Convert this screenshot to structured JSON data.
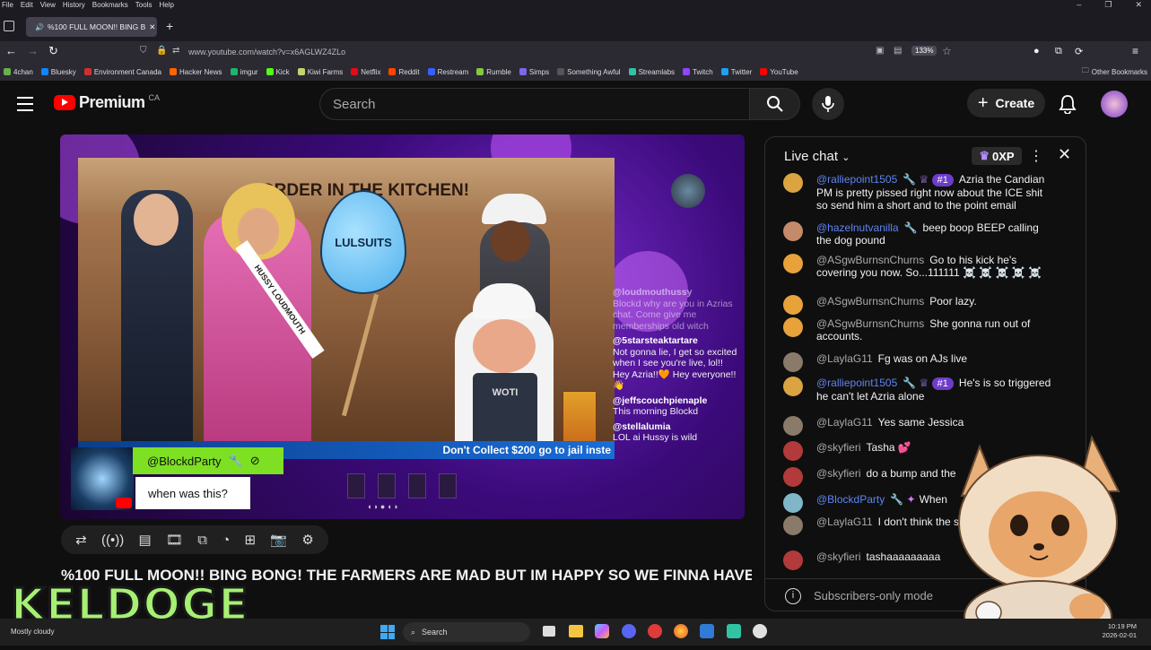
{
  "browser": {
    "menu": [
      "File",
      "Edit",
      "View",
      "History",
      "Bookmarks",
      "Tools",
      "Help"
    ],
    "tab_title": "%100 FULL MOON!! BING B",
    "url": "www.youtube.com/watch?v=x6AGLWZ4ZLo",
    "zoom": "133%",
    "bookmarks": [
      {
        "label": "4chan",
        "color": "#6ab04c"
      },
      {
        "label": "Bluesky",
        "color": "#1185fe"
      },
      {
        "label": "Environment Canada",
        "color": "#d32f2f"
      },
      {
        "label": "Hacker News",
        "color": "#ff6600"
      },
      {
        "label": "imgur",
        "color": "#1bb76e"
      },
      {
        "label": "Kick",
        "color": "#53fc18"
      },
      {
        "label": "Kiwi Farms",
        "color": "#c6d36b"
      },
      {
        "label": "Netflix",
        "color": "#e50914"
      },
      {
        "label": "Reddit",
        "color": "#ff4500"
      },
      {
        "label": "Restream",
        "color": "#3461ff"
      },
      {
        "label": "Rumble",
        "color": "#85c742"
      },
      {
        "label": "Simps",
        "color": "#7b68ee"
      },
      {
        "label": "Something Awful",
        "color": "#333333"
      },
      {
        "label": "Streamlabs",
        "color": "#31c3a2"
      },
      {
        "label": "Twitch",
        "color": "#9146ff"
      },
      {
        "label": "Twitter",
        "color": "#1da1f2"
      },
      {
        "label": "YouTube",
        "color": "#ff0000"
      }
    ],
    "other_bookmarks": "Other Bookmarks"
  },
  "youtube": {
    "logo_text": "Premium",
    "logo_region": "CA",
    "search_placeholder": "Search",
    "create_label": "Create",
    "accent": "#ff0000"
  },
  "video": {
    "art_heading": "ORDER IN THE KITCHEN!",
    "drop_label": "LULSUITS",
    "sash_label": "HUSSY LOUDMOUTH",
    "apron_label": "WOTI",
    "ticker": "Don't Collect $200 go to jail inste",
    "alert_user": "@BlockdParty",
    "alert_message": "when was this?",
    "overlay_chat": [
      {
        "user": "@loudmouthussy",
        "text": "Blockd why are you in Azrias chat. Come give me memberships old witch"
      },
      {
        "user": "@5starsteaktartare",
        "text": "Not gonna lie, I get so excited when I see you're live, lol!! Hey Azria!!🧡 Hey everyone!! 👋"
      },
      {
        "user": "@jeffscouchpienaple",
        "text": "This morning Blockd"
      },
      {
        "user": "@stellalumia",
        "text": "LOL ai Hussy is wild"
      }
    ],
    "title": "%100 FULL MOON!! BING BONG! THE FARMERS ARE MAD BUT IM HAPPY SO WE FINNA HAVE"
  },
  "controls": [
    "replay-icon",
    "live-icon",
    "captions-icon",
    "film-icon",
    "pip-icon",
    "speed-icon",
    "clip-icon",
    "screenshot-icon",
    "settings-icon"
  ],
  "chat": {
    "header": "Live chat",
    "xp": "0XP",
    "messages": [
      {
        "author": "@ralliepoint1505",
        "mod": true,
        "rank": "#1",
        "text": "Azria the Candian PM is pretty pissed right now about the ICE shit so send him a short and to the point email",
        "avatar": "#d9a441"
      },
      {
        "author": "@hazelnutvanilla",
        "mod": true,
        "rank": "",
        "text": "beep boop BEEP calling the dog pound",
        "avatar": "#c48a6a"
      },
      {
        "author": "@ASgwBurnsnChurns",
        "mod": false,
        "rank": "",
        "text": "Go to his kick he's covering you now. So...111111 ☠️ ☠️ ☠️ ☠️ ☠️",
        "avatar": "#e8a23a"
      },
      {
        "author": "@ASgwBurnsnChurns",
        "mod": false,
        "rank": "",
        "text": "Poor lazy.",
        "avatar": "#e8a23a"
      },
      {
        "author": "@ASgwBurnsnChurns",
        "mod": false,
        "rank": "",
        "text": "She gonna run out of accounts.",
        "avatar": "#e8a23a"
      },
      {
        "author": "@LaylaG11",
        "mod": false,
        "rank": "",
        "text": "Fg was on AJs live",
        "avatar": "#8a7a6a"
      },
      {
        "author": "@ralliepoint1505",
        "mod": true,
        "rank": "#1",
        "text": "He's is so triggered he can't let Azria alone",
        "avatar": "#d9a441"
      },
      {
        "author": "@LaylaG11",
        "mod": false,
        "rank": "",
        "text": "Yes same Jessica",
        "avatar": "#8a7a6a"
      },
      {
        "author": "@skyfieri",
        "mod": false,
        "rank": "",
        "text": "Tasha 💕",
        "avatar": "#b33a3a"
      },
      {
        "author": "@skyfieri",
        "mod": false,
        "rank": "",
        "text": "do a bump and the",
        "avatar": "#b33a3a"
      },
      {
        "author": "@BlockdParty",
        "mod": true,
        "rank": "",
        "text": "When",
        "avatar": "#7fb7c9"
      },
      {
        "author": "@LaylaG11",
        "mod": false,
        "rank": "",
        "text": "I don't think the stay long",
        "avatar": "#8a7a6a"
      },
      {
        "author": "@skyfieri",
        "mod": false,
        "rank": "",
        "text": "tashaaaaaaaaa",
        "avatar": "#b33a3a"
      }
    ],
    "subscribers_only": "Subscribers-only mode"
  },
  "overlay": {
    "keldoge": "KELDOGE"
  },
  "taskbar": {
    "weather": "Mostly cloudy",
    "search": "Search",
    "time": "10:19 PM",
    "date": "2026-02-01"
  }
}
